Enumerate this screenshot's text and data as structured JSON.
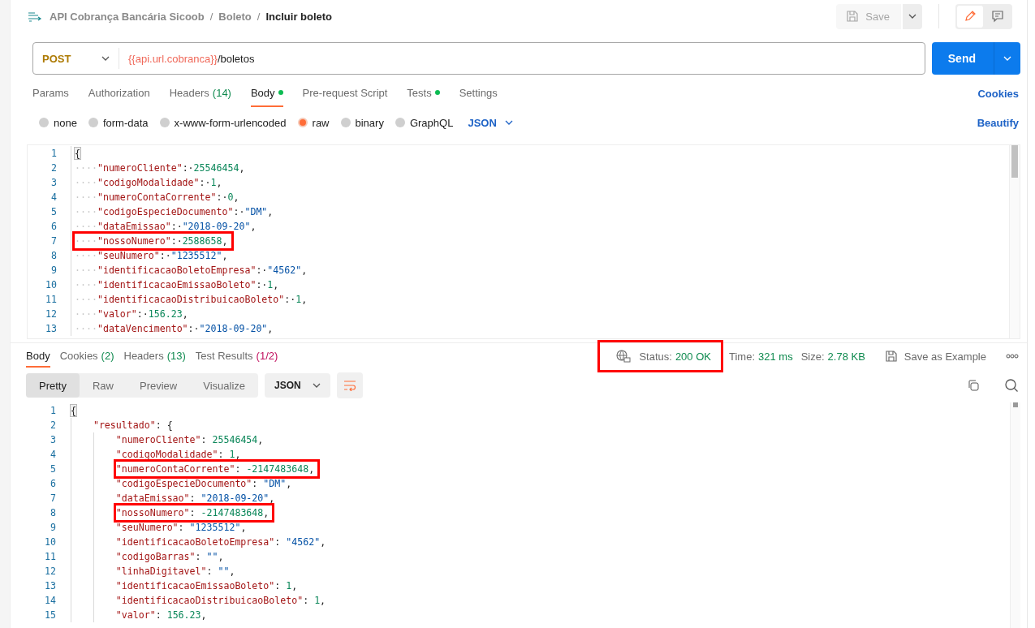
{
  "header": {
    "breadcrumbs": [
      {
        "label": "API Cobrança Bancária Sicoob",
        "current": false
      },
      {
        "label": "Boleto",
        "current": false
      },
      {
        "label": "Incluir boleto",
        "current": true
      }
    ],
    "separator": "/",
    "save_label": "Save",
    "mode_buttons": [
      {
        "kind": "edit",
        "selected": true
      },
      {
        "kind": "comment",
        "selected": false
      }
    ]
  },
  "request": {
    "method": "POST",
    "url_variable": "{{api.url.cobranca}}",
    "url_path": "/boletos",
    "send_label": "Send"
  },
  "request_tabs": [
    {
      "label": "Params",
      "dot": false,
      "selected": false
    },
    {
      "label": "Authorization",
      "dot": false,
      "selected": false
    },
    {
      "label": "Headers",
      "count": "(14)",
      "dot": false,
      "selected": false
    },
    {
      "label": "Body",
      "dot": true,
      "selected": true
    },
    {
      "label": "Pre-request Script",
      "dot": false,
      "selected": false
    },
    {
      "label": "Tests",
      "dot": true,
      "selected": false
    },
    {
      "label": "Settings",
      "dot": false,
      "selected": false
    }
  ],
  "cookies_link": "Cookies",
  "body_types": [
    {
      "label": "none",
      "selected": false
    },
    {
      "label": "form-data",
      "selected": false
    },
    {
      "label": "x-www-form-urlencoded",
      "selected": false
    },
    {
      "label": "raw",
      "selected": true
    },
    {
      "label": "binary",
      "selected": false
    },
    {
      "label": "GraphQL",
      "selected": false
    }
  ],
  "body_format": "JSON",
  "beautify_link": "Beautify",
  "request_body": [
    {
      "number": "1",
      "highlighted": false,
      "tokens": [
        {
          "text": "{",
          "kind": "brace"
        }
      ]
    },
    {
      "number": "2",
      "highlighted": false,
      "tokens": [
        {
          "text": "····",
          "kind": "ws"
        },
        {
          "text": "\"numeroCliente\"",
          "kind": "key"
        },
        {
          "text": ":·",
          "kind": "punct"
        },
        {
          "text": "25546454",
          "kind": "number"
        },
        {
          "text": ",",
          "kind": "punct"
        }
      ]
    },
    {
      "number": "3",
      "highlighted": false,
      "tokens": [
        {
          "text": "····",
          "kind": "ws"
        },
        {
          "text": "\"codigoModalidade\"",
          "kind": "key"
        },
        {
          "text": ":·",
          "kind": "punct"
        },
        {
          "text": "1",
          "kind": "number"
        },
        {
          "text": ",",
          "kind": "punct"
        }
      ]
    },
    {
      "number": "4",
      "highlighted": false,
      "tokens": [
        {
          "text": "····",
          "kind": "ws"
        },
        {
          "text": "\"numeroContaCorrente\"",
          "kind": "key"
        },
        {
          "text": ":·",
          "kind": "punct"
        },
        {
          "text": "0",
          "kind": "number"
        },
        {
          "text": ",",
          "kind": "punct"
        }
      ]
    },
    {
      "number": "5",
      "highlighted": false,
      "tokens": [
        {
          "text": "····",
          "kind": "ws"
        },
        {
          "text": "\"codigoEspecieDocumento\"",
          "kind": "key"
        },
        {
          "text": ":·",
          "kind": "punct"
        },
        {
          "text": "\"DM\"",
          "kind": "string"
        },
        {
          "text": ",",
          "kind": "punct"
        }
      ]
    },
    {
      "number": "6",
      "highlighted": false,
      "tokens": [
        {
          "text": "····",
          "kind": "ws"
        },
        {
          "text": "\"dataEmissao\"",
          "kind": "key"
        },
        {
          "text": ":·",
          "kind": "punct"
        },
        {
          "text": "\"2018-09-20\"",
          "kind": "string"
        },
        {
          "text": ",",
          "kind": "punct"
        }
      ]
    },
    {
      "number": "7",
      "highlighted": true,
      "tokens": [
        {
          "text": "····",
          "kind": "ws"
        },
        {
          "text": "\"nossoNumero\"",
          "kind": "key"
        },
        {
          "text": ":·",
          "kind": "punct"
        },
        {
          "text": "2588658",
          "kind": "number"
        },
        {
          "text": ",",
          "kind": "punct"
        }
      ]
    },
    {
      "number": "8",
      "highlighted": false,
      "tokens": [
        {
          "text": "····",
          "kind": "ws"
        },
        {
          "text": "\"seuNumero\"",
          "kind": "key"
        },
        {
          "text": ":·",
          "kind": "punct"
        },
        {
          "text": "\"1235512\"",
          "kind": "string"
        },
        {
          "text": ",",
          "kind": "punct"
        }
      ]
    },
    {
      "number": "9",
      "highlighted": false,
      "tokens": [
        {
          "text": "····",
          "kind": "ws"
        },
        {
          "text": "\"identificacaoBoletoEmpresa\"",
          "kind": "key"
        },
        {
          "text": ":·",
          "kind": "punct"
        },
        {
          "text": "\"4562\"",
          "kind": "string"
        },
        {
          "text": ",",
          "kind": "punct"
        }
      ]
    },
    {
      "number": "10",
      "highlighted": false,
      "tokens": [
        {
          "text": "····",
          "kind": "ws"
        },
        {
          "text": "\"identificacaoEmissaoBoleto\"",
          "kind": "key"
        },
        {
          "text": ":·",
          "kind": "punct"
        },
        {
          "text": "1",
          "kind": "number"
        },
        {
          "text": ",",
          "kind": "punct"
        }
      ]
    },
    {
      "number": "11",
      "highlighted": false,
      "tokens": [
        {
          "text": "····",
          "kind": "ws"
        },
        {
          "text": "\"identificacaoDistribuicaoBoleto\"",
          "kind": "key"
        },
        {
          "text": ":·",
          "kind": "punct"
        },
        {
          "text": "1",
          "kind": "number"
        },
        {
          "text": ",",
          "kind": "punct"
        }
      ]
    },
    {
      "number": "12",
      "highlighted": false,
      "tokens": [
        {
          "text": "····",
          "kind": "ws"
        },
        {
          "text": "\"valor\"",
          "kind": "key"
        },
        {
          "text": ":·",
          "kind": "punct"
        },
        {
          "text": "156.23",
          "kind": "number"
        },
        {
          "text": ",",
          "kind": "punct"
        }
      ]
    },
    {
      "number": "13",
      "highlighted": false,
      "tokens": [
        {
          "text": "····",
          "kind": "ws"
        },
        {
          "text": "\"dataVencimento\"",
          "kind": "key"
        },
        {
          "text": ":·",
          "kind": "punct"
        },
        {
          "text": "\"2018-09-20\"",
          "kind": "string"
        },
        {
          "text": ",",
          "kind": "punct"
        }
      ]
    }
  ],
  "response_tabs": [
    {
      "label": "Body",
      "selected": true
    },
    {
      "label": "Cookies",
      "count": "(2)",
      "color": "#0f8a4f",
      "selected": false
    },
    {
      "label": "Headers",
      "count": "(13)",
      "color": "#0f8a4f",
      "selected": false
    },
    {
      "label": "Test Results",
      "count": "(1/2)",
      "color": "#c00d5c",
      "selected": false
    }
  ],
  "response_meta": [
    {
      "label": "Status:",
      "value": "200 OK",
      "highlighted": true
    },
    {
      "label": "Time:",
      "value": "321 ms",
      "highlighted": false
    },
    {
      "label": "Size:",
      "value": "2.78 KB",
      "highlighted": false
    }
  ],
  "save_example_label": "Save as Example",
  "view_modes": [
    {
      "label": "Pretty",
      "selected": true
    },
    {
      "label": "Raw",
      "selected": false
    },
    {
      "label": "Preview",
      "selected": false
    },
    {
      "label": "Visualize",
      "selected": false
    }
  ],
  "response_format": "JSON",
  "response_body": [
    {
      "number": "1",
      "highlighted": false,
      "tokens": [
        {
          "text": "{",
          "kind": "brace"
        }
      ],
      "children": [
        {
          "number": "2",
          "highlighted": false,
          "tokens": [
            {
              "text": "\"resultado\"",
              "kind": "key"
            },
            {
              "text": ": {",
              "kind": "punct"
            }
          ],
          "children": [
            {
              "number": "3",
              "highlighted": false,
              "tokens": [
                {
                  "text": "\"numeroCliente\"",
                  "kind": "key"
                },
                {
                  "text": ": ",
                  "kind": "punct"
                },
                {
                  "text": "25546454",
                  "kind": "number"
                },
                {
                  "text": ",",
                  "kind": "punct"
                }
              ]
            },
            {
              "number": "4",
              "highlighted": false,
              "tokens": [
                {
                  "text": "\"codigoModalidade\"",
                  "kind": "key"
                },
                {
                  "text": ": ",
                  "kind": "punct"
                },
                {
                  "text": "1",
                  "kind": "number"
                },
                {
                  "text": ",",
                  "kind": "punct"
                }
              ]
            },
            {
              "number": "5",
              "highlighted": true,
              "tokens": [
                {
                  "text": "\"numeroContaCorrente\"",
                  "kind": "key"
                },
                {
                  "text": ": ",
                  "kind": "punct"
                },
                {
                  "text": "-2147483648",
                  "kind": "number"
                },
                {
                  "text": ",",
                  "kind": "punct"
                }
              ]
            },
            {
              "number": "6",
              "highlighted": false,
              "tokens": [
                {
                  "text": "\"codigoEspecieDocumento\"",
                  "kind": "key"
                },
                {
                  "text": ": ",
                  "kind": "punct"
                },
                {
                  "text": "\"DM\"",
                  "kind": "string"
                },
                {
                  "text": ",",
                  "kind": "punct"
                }
              ]
            },
            {
              "number": "7",
              "highlighted": false,
              "tokens": [
                {
                  "text": "\"dataEmissao\"",
                  "kind": "key"
                },
                {
                  "text": ": ",
                  "kind": "punct"
                },
                {
                  "text": "\"2018-09-20\"",
                  "kind": "string"
                },
                {
                  "text": ",",
                  "kind": "punct"
                }
              ]
            },
            {
              "number": "8",
              "highlighted": true,
              "tokens": [
                {
                  "text": "\"nossoNumero\"",
                  "kind": "key"
                },
                {
                  "text": ": ",
                  "kind": "punct"
                },
                {
                  "text": "-2147483648",
                  "kind": "number"
                },
                {
                  "text": ",",
                  "kind": "punct"
                }
              ]
            },
            {
              "number": "9",
              "highlighted": false,
              "tokens": [
                {
                  "text": "\"seuNumero\"",
                  "kind": "key"
                },
                {
                  "text": ": ",
                  "kind": "punct"
                },
                {
                  "text": "\"1235512\"",
                  "kind": "string"
                },
                {
                  "text": ",",
                  "kind": "punct"
                }
              ]
            },
            {
              "number": "10",
              "highlighted": false,
              "tokens": [
                {
                  "text": "\"identificacaoBoletoEmpresa\"",
                  "kind": "key"
                },
                {
                  "text": ": ",
                  "kind": "punct"
                },
                {
                  "text": "\"4562\"",
                  "kind": "string"
                },
                {
                  "text": ",",
                  "kind": "punct"
                }
              ]
            },
            {
              "number": "11",
              "highlighted": false,
              "tokens": [
                {
                  "text": "\"codigoBarras\"",
                  "kind": "key"
                },
                {
                  "text": ": ",
                  "kind": "punct"
                },
                {
                  "text": "\"\"",
                  "kind": "string"
                },
                {
                  "text": ",",
                  "kind": "punct"
                }
              ]
            },
            {
              "number": "12",
              "highlighted": false,
              "tokens": [
                {
                  "text": "\"linhaDigitavel\"",
                  "kind": "key"
                },
                {
                  "text": ": ",
                  "kind": "punct"
                },
                {
                  "text": "\"\"",
                  "kind": "string"
                },
                {
                  "text": ",",
                  "kind": "punct"
                }
              ]
            },
            {
              "number": "13",
              "highlighted": false,
              "tokens": [
                {
                  "text": "\"identificacaoEmissaoBoleto\"",
                  "kind": "key"
                },
                {
                  "text": ": ",
                  "kind": "punct"
                },
                {
                  "text": "1",
                  "kind": "number"
                },
                {
                  "text": ",",
                  "kind": "punct"
                }
              ]
            },
            {
              "number": "14",
              "highlighted": false,
              "tokens": [
                {
                  "text": "\"identificacaoDistribuicaoBoleto\"",
                  "kind": "key"
                },
                {
                  "text": ": ",
                  "kind": "punct"
                },
                {
                  "text": "1",
                  "kind": "number"
                },
                {
                  "text": ",",
                  "kind": "punct"
                }
              ]
            },
            {
              "number": "15",
              "highlighted": false,
              "tokens": [
                {
                  "text": "\"valor\"",
                  "kind": "key"
                },
                {
                  "text": ": ",
                  "kind": "punct"
                },
                {
                  "text": "156.23",
                  "kind": "number"
                },
                {
                  "text": ",",
                  "kind": "punct"
                }
              ]
            }
          ]
        }
      ]
    }
  ]
}
